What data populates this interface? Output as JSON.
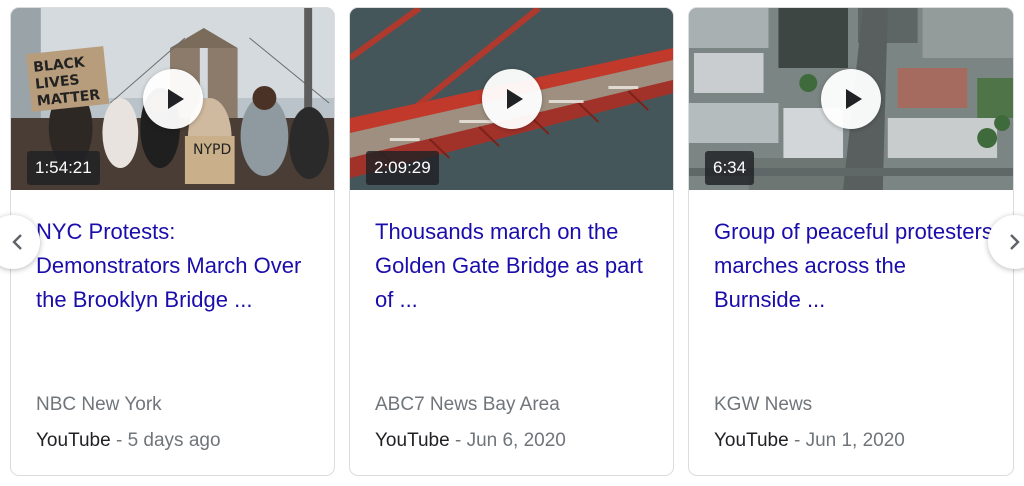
{
  "carousel": {
    "cards": [
      {
        "duration": "1:54:21",
        "title": "NYC Protests: Demonstrators March Over the Brooklyn Bridge ...",
        "source": "NBC New York",
        "platform": "YouTube",
        "separator": " - ",
        "date": "5 days ago",
        "sign_text_1": "BLACK LIVES MATTER",
        "sign_text_2": "NYPD"
      },
      {
        "duration": "2:09:29",
        "title": "Thousands march on the Golden Gate Bridge as part of ...",
        "source": "ABC7 News Bay Area",
        "platform": "YouTube",
        "separator": " - ",
        "date": "Jun 6, 2020"
      },
      {
        "duration": "6:34",
        "title": "Group of peaceful protesters marches across the Burnside ...",
        "source": "KGW News",
        "platform": "YouTube",
        "separator": " - ",
        "date": "Jun 1, 2020"
      }
    ],
    "prev_icon": "chevron-left-icon",
    "next_icon": "chevron-right-icon"
  },
  "colors": {
    "title_link": "#1a0dab",
    "muted_text": "#70757a",
    "bridge_red": "#c0392b"
  }
}
